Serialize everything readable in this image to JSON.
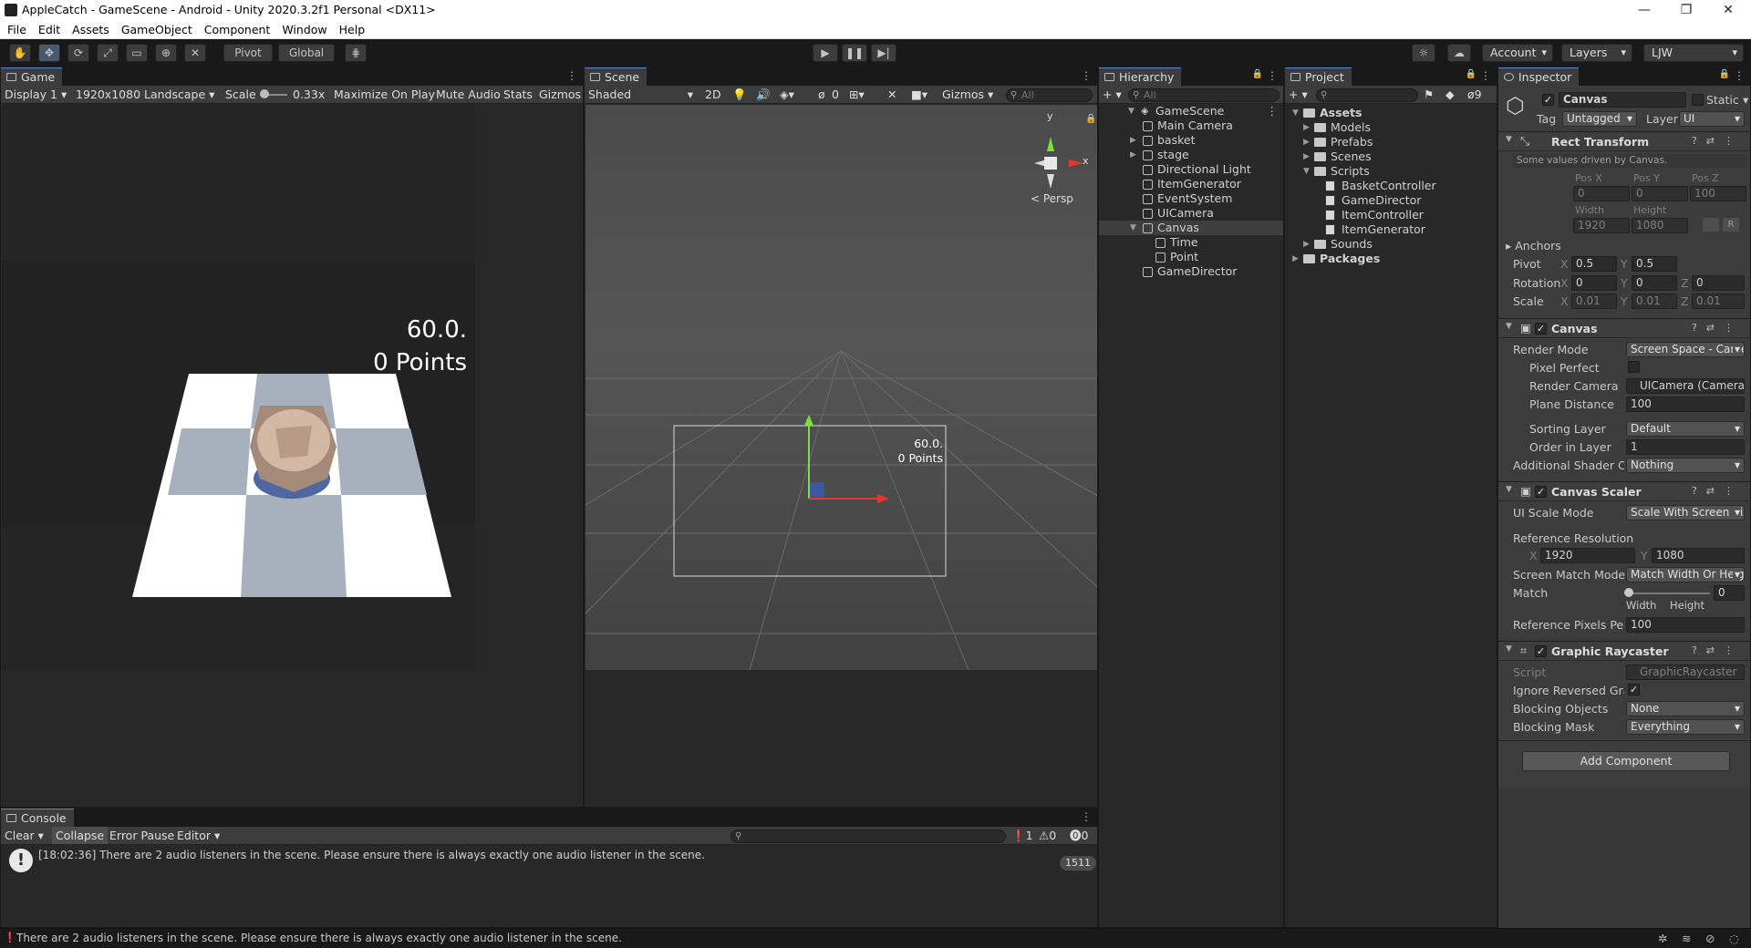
{
  "window": {
    "title": "AppleCatch - GameScene - Android - Unity 2020.3.2f1 Personal <DX11>",
    "controls": {
      "minimize": "—",
      "maximize": "❐",
      "close": "✕"
    }
  },
  "menu": [
    "File",
    "Edit",
    "Assets",
    "GameObject",
    "Component",
    "Window",
    "Help"
  ],
  "toolbar": {
    "pivot_label": "Pivot",
    "global_label": "Global",
    "account_label": "Account",
    "layers_label": "Layers",
    "layout_label": "LJW"
  },
  "game": {
    "tab": "Game",
    "display": "Display 1",
    "resolution": "1920x1080 Landscape",
    "scale_label": "Scale",
    "scale_value": "0.33x",
    "maximize": "Maximize On Play",
    "mute": "Mute Audio",
    "stats": "Stats",
    "gizmos": "Gizmos",
    "time_text": "60.0.",
    "points_text": "0 Points"
  },
  "scene": {
    "tab": "Scene",
    "shading": "Shaded",
    "mode_2d": "2D",
    "hidden_count": "0",
    "gizmos": "Gizmos",
    "search_placeholder": "All",
    "persp_label": "< Persp",
    "gizmo_y": "y",
    "gizmo_x": "x",
    "time_text": "60.0.",
    "points_text": "0 Points"
  },
  "hierarchy": {
    "tab": "Hierarchy",
    "search_placeholder": "All",
    "scene_name": "GameScene",
    "items": [
      {
        "label": "Main Camera",
        "depth": 1,
        "expand": false,
        "selected": false
      },
      {
        "label": "basket",
        "depth": 1,
        "expand": true,
        "selected": false
      },
      {
        "label": "stage",
        "depth": 1,
        "expand": true,
        "selected": false
      },
      {
        "label": "Directional Light",
        "depth": 1,
        "expand": false,
        "selected": false
      },
      {
        "label": "ItemGenerator",
        "depth": 1,
        "expand": false,
        "selected": false
      },
      {
        "label": "EventSystem",
        "depth": 1,
        "expand": false,
        "selected": false
      },
      {
        "label": "UICamera",
        "depth": 1,
        "expand": false,
        "selected": false
      },
      {
        "label": "Canvas",
        "depth": 1,
        "expand": true,
        "selected": true
      },
      {
        "label": "Time",
        "depth": 2,
        "expand": false,
        "selected": false
      },
      {
        "label": "Point",
        "depth": 2,
        "expand": false,
        "selected": false
      },
      {
        "label": "GameDirector",
        "depth": 1,
        "expand": false,
        "selected": false
      }
    ]
  },
  "project": {
    "tab": "Project",
    "hidden_count": "9",
    "tree": [
      {
        "label": "Assets",
        "depth": 0,
        "kind": "folder",
        "bold": true
      },
      {
        "label": "Models",
        "depth": 1,
        "kind": "folder",
        "bold": false
      },
      {
        "label": "Prefabs",
        "depth": 1,
        "kind": "folder",
        "bold": false
      },
      {
        "label": "Scenes",
        "depth": 1,
        "kind": "folder",
        "bold": false
      },
      {
        "label": "Scripts",
        "depth": 1,
        "kind": "folder",
        "bold": false
      },
      {
        "label": "BasketController",
        "depth": 2,
        "kind": "script",
        "bold": false
      },
      {
        "label": "GameDirector",
        "depth": 2,
        "kind": "script",
        "bold": false
      },
      {
        "label": "ItemController",
        "depth": 2,
        "kind": "script",
        "bold": false
      },
      {
        "label": "ItemGenerator",
        "depth": 2,
        "kind": "script",
        "bold": false
      },
      {
        "label": "Sounds",
        "depth": 1,
        "kind": "folder",
        "bold": false
      },
      {
        "label": "Packages",
        "depth": 0,
        "kind": "folder",
        "bold": true
      }
    ]
  },
  "inspector": {
    "tab": "Inspector",
    "object_name": "Canvas",
    "static_label": "Static",
    "tag_label": "Tag",
    "tag_value": "Untagged",
    "layer_label": "Layer",
    "layer_value": "UI",
    "rect": {
      "title": "Rect Transform",
      "note": "Some values driven by Canvas.",
      "posx_label": "Pos X",
      "posy_label": "Pos Y",
      "posz_label": "Pos Z",
      "posx": "0",
      "posy": "0",
      "posz": "100",
      "width_label": "Width",
      "height_label": "Height",
      "width": "1920",
      "height": "1080",
      "r_btn": "R",
      "anchors": "Anchors",
      "pivot_label": "Pivot",
      "pivot_x": "0.5",
      "pivot_y": "0.5",
      "rotation_label": "Rotation",
      "rot_x": "0",
      "rot_y": "0",
      "rot_z": "0",
      "scale_label": "Scale",
      "scale_x": "0.01",
      "scale_y": "0.01",
      "scale_z": "0.01"
    },
    "canvas": {
      "title": "Canvas",
      "render_mode_label": "Render Mode",
      "render_mode": "Screen Space - Camera",
      "pixel_perfect_label": "Pixel Perfect",
      "render_camera_label": "Render Camera",
      "render_camera": "UICamera (Camera)",
      "plane_distance_label": "Plane Distance",
      "plane_distance": "100",
      "sorting_layer_label": "Sorting Layer",
      "sorting_layer": "Default",
      "order_label": "Order in Layer",
      "order": "1",
      "shader_label": "Additional Shader Channels",
      "shader": "Nothing"
    },
    "scaler": {
      "title": "Canvas Scaler",
      "ui_scale_label": "UI Scale Mode",
      "ui_scale": "Scale With Screen Size",
      "ref_res_label": "Reference Resolution",
      "ref_x": "1920",
      "ref_y": "1080",
      "match_mode_label": "Screen Match Mode",
      "match_mode": "Match Width Or Height",
      "match_label": "Match",
      "match_value": "0",
      "match_fraction": 0,
      "width_label": "Width",
      "height_label": "Height",
      "ppu_label": "Reference Pixels Per Unit",
      "ppu": "100"
    },
    "raycaster": {
      "title": "Graphic Raycaster",
      "script_label": "Script",
      "script": "GraphicRaycaster",
      "ignore_label": "Ignore Reversed Graphics",
      "blocking_objects_label": "Blocking Objects",
      "blocking_objects": "None",
      "blocking_mask_label": "Blocking Mask",
      "blocking_mask": "Everything"
    },
    "add_component": "Add Component"
  },
  "console": {
    "tab": "Console",
    "clear": "Clear",
    "collapse": "Collapse",
    "error_pause": "Error Pause",
    "editor": "Editor",
    "count_info": "1",
    "count_warn": "0",
    "count_error": "0",
    "entry_text": "[18:02:36] There are 2 audio listeners in the scene. Please ensure there is always exactly one audio listener in the scene.",
    "entry_count": "1511"
  },
  "status": {
    "message": "There are 2 audio listeners in the scene. Please ensure there is always exactly one audio listener in the scene."
  },
  "colors": {
    "accent": "#5a8ad6",
    "panel": "#282828",
    "header": "#3c3c3c",
    "selection": "#3e3e3e"
  }
}
